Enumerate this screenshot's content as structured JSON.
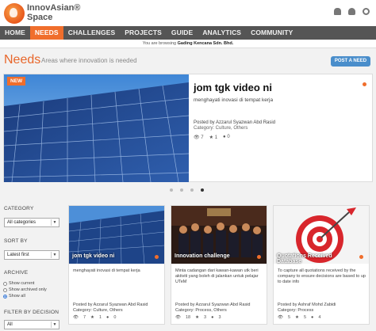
{
  "brand": {
    "name": "InnovAsian®",
    "name2": "Space"
  },
  "header_icons": [
    "bell-icon",
    "user-icon",
    "gear-icon"
  ],
  "nav": {
    "items": [
      {
        "label": "HOME"
      },
      {
        "label": "NEEDS"
      },
      {
        "label": "CHALLENGES"
      },
      {
        "label": "PROJECTS"
      },
      {
        "label": "GUIDE"
      },
      {
        "label": "ANALYTICS"
      },
      {
        "label": "COMMUNITY"
      }
    ],
    "active": "NEEDS"
  },
  "browsing": {
    "prefix": "You are browsing",
    "company": "Gading Kencana Sdn. Bhd."
  },
  "page": {
    "title": "Needs",
    "subtitle": "Areas where innovation is needed",
    "post_button": "POST A NEED"
  },
  "featured": {
    "badge": "NEW",
    "title": "jom tgk video ni",
    "description": "menghayati inovasi di tempat kerja",
    "posted_by": "Posted by Azzarul Syazwan Abd Rasid",
    "category": "Category: Culture, Others",
    "stats": {
      "views": "7",
      "likes": "1",
      "comments": "0"
    }
  },
  "carousel": {
    "count": 4,
    "active_index": 3
  },
  "sidebar": {
    "category_label": "CATEGORY",
    "category_value": "All categories",
    "sort_label": "SORT BY",
    "sort_value": "Latest first",
    "archive_label": "ARCHIVE",
    "archive_options": [
      "Show current",
      "Show archived only",
      "Show all"
    ],
    "archive_selected": 2,
    "filter_label": "FILTER BY DECISION",
    "filter_value": "All"
  },
  "cards": [
    {
      "caption": "jom tgk video ni",
      "description": "menghayati inovasi di tempat kerja",
      "posted_by": "Posted by Azzarul Syazwan Abd Rasid",
      "category": "Category: Culture, Others",
      "stats": {
        "views": "7",
        "likes": "1",
        "comments": "0"
      }
    },
    {
      "caption": "Innovation challenge",
      "description": "Minta cadangan dari kawan-kawan utk beri aktiviti yang boleh di jalankan untuk pelajar UTeM",
      "posted_by": "Posted by Azzarul Syazwan Abd Rasid",
      "category": "Category: Process, Others",
      "stats": {
        "views": "18",
        "likes": "3",
        "comments": "3"
      }
    },
    {
      "caption": "Quotations Received Database",
      "description": "To capture all quotations received by the company to ensure decisions are based to up to date info",
      "posted_by": "Posted by Ashraf Mohd Zabidi",
      "category": "Category: Process",
      "stats": {
        "views": "5",
        "likes": "5",
        "comments": "4"
      }
    }
  ],
  "colors": {
    "accent": "#f06e2c",
    "nav_bg": "#555555",
    "button_blue": "#4a8ecb"
  }
}
